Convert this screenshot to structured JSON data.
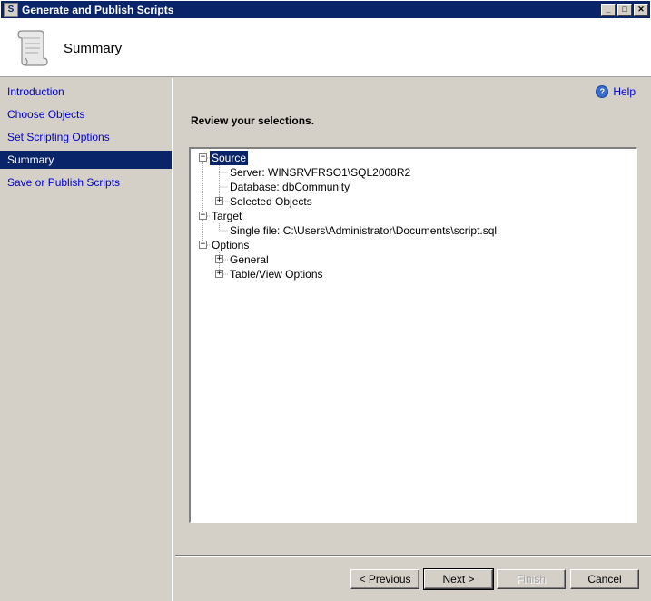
{
  "window": {
    "title": "Generate and Publish Scripts",
    "buttons": {
      "minimize": "_",
      "maximize": "□",
      "close": "✕"
    }
  },
  "header": {
    "title": "Summary"
  },
  "sidebar": {
    "items": [
      {
        "label": "Introduction",
        "active": false
      },
      {
        "label": "Choose Objects",
        "active": false
      },
      {
        "label": "Set Scripting Options",
        "active": false
      },
      {
        "label": "Summary",
        "active": true
      },
      {
        "label": "Save or Publish Scripts",
        "active": false
      }
    ]
  },
  "main": {
    "help_label": "Help",
    "review_heading": "Review your selections."
  },
  "tree": {
    "source": {
      "label": "Source",
      "server": "Server: WINSRVFRSO1\\SQL2008R2",
      "database": "Database: dbCommunity",
      "selected_objects": "Selected Objects"
    },
    "target": {
      "label": "Target",
      "single_file": "Single file: C:\\Users\\Administrator\\Documents\\script.sql"
    },
    "options": {
      "label": "Options",
      "general": "General",
      "table_view": "Table/View Options"
    }
  },
  "footer": {
    "previous": "< Previous",
    "next": "Next >",
    "finish": "Finish",
    "cancel": "Cancel"
  }
}
